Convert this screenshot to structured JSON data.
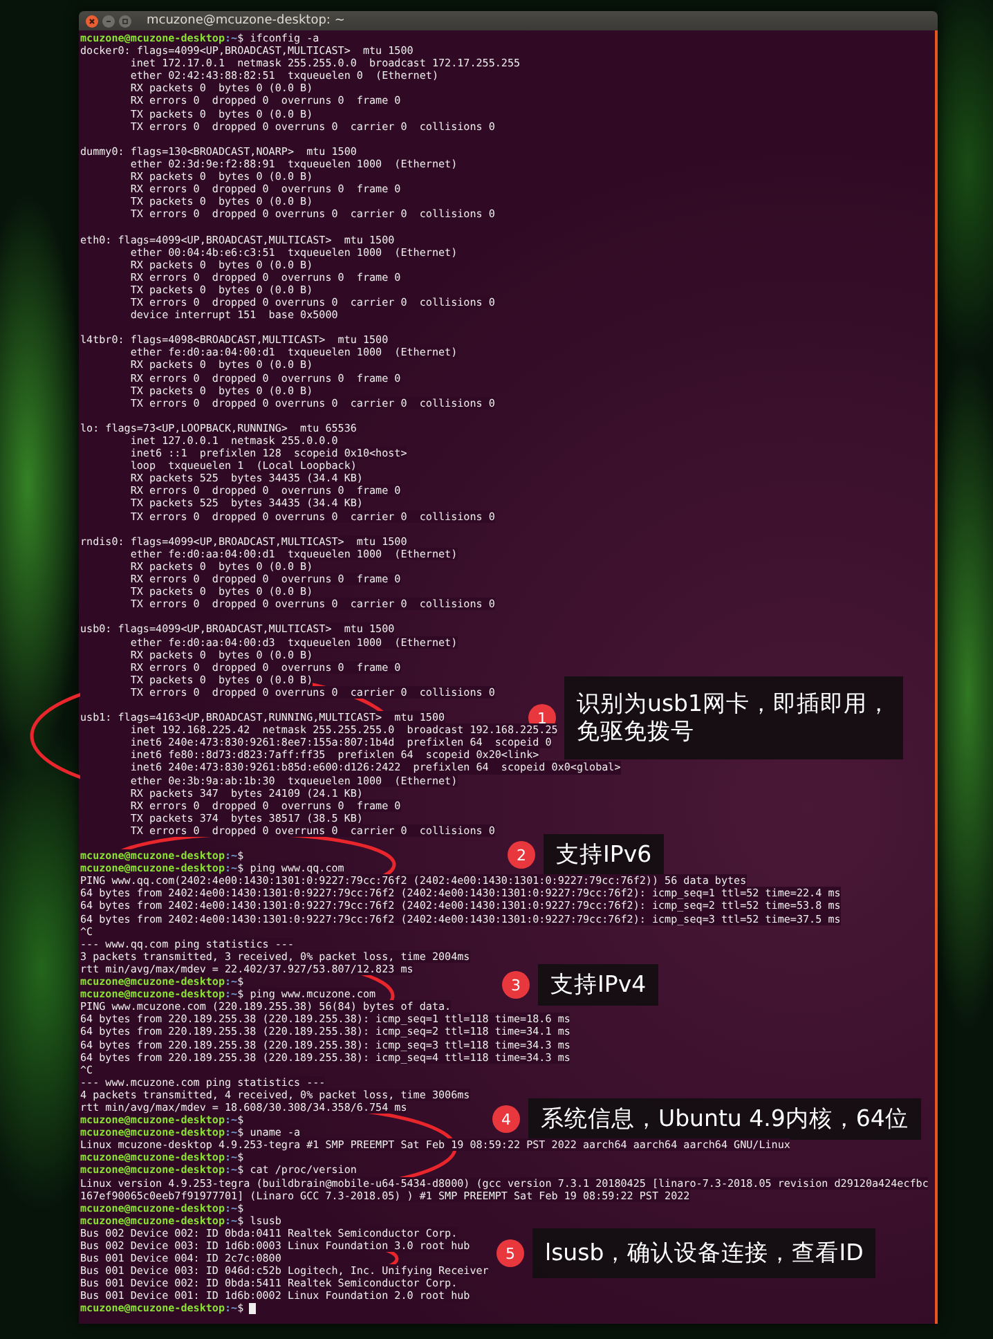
{
  "window": {
    "title": "mcuzone@mcuzone-desktop: ~"
  },
  "terminal": {
    "cursor": true,
    "lines": [
      {
        "kind": "prompt",
        "user": "mcuzone@mcuzone-desktop",
        "path": ":~",
        "command": "$ ifconfig -a"
      },
      {
        "kind": "out",
        "text": "docker0: flags=4099<UP,BROADCAST,MULTICAST>  mtu 1500"
      },
      {
        "kind": "out",
        "text": "        inet 172.17.0.1  netmask 255.255.0.0  broadcast 172.17.255.255"
      },
      {
        "kind": "out",
        "text": "        ether 02:42:43:88:82:51  txqueuelen 0  (Ethernet)"
      },
      {
        "kind": "out",
        "text": "        RX packets 0  bytes 0 (0.0 B)"
      },
      {
        "kind": "out",
        "text": "        RX errors 0  dropped 0  overruns 0  frame 0"
      },
      {
        "kind": "out",
        "text": "        TX packets 0  bytes 0 (0.0 B)"
      },
      {
        "kind": "out",
        "text": "        TX errors 0  dropped 0 overruns 0  carrier 0  collisions 0"
      },
      {
        "kind": "blank"
      },
      {
        "kind": "out",
        "text": "dummy0: flags=130<BROADCAST,NOARP>  mtu 1500"
      },
      {
        "kind": "out",
        "text": "        ether 02:3d:9e:f2:88:91  txqueuelen 1000  (Ethernet)"
      },
      {
        "kind": "out",
        "text": "        RX packets 0  bytes 0 (0.0 B)"
      },
      {
        "kind": "out",
        "text": "        RX errors 0  dropped 0  overruns 0  frame 0"
      },
      {
        "kind": "out",
        "text": "        TX packets 0  bytes 0 (0.0 B)"
      },
      {
        "kind": "out",
        "text": "        TX errors 0  dropped 0 overruns 0  carrier 0  collisions 0"
      },
      {
        "kind": "blank"
      },
      {
        "kind": "out",
        "text": "eth0: flags=4099<UP,BROADCAST,MULTICAST>  mtu 1500"
      },
      {
        "kind": "out",
        "text": "        ether 00:04:4b:e6:c3:51  txqueuelen 1000  (Ethernet)"
      },
      {
        "kind": "out",
        "text": "        RX packets 0  bytes 0 (0.0 B)"
      },
      {
        "kind": "out",
        "text": "        RX errors 0  dropped 0  overruns 0  frame 0"
      },
      {
        "kind": "out",
        "text": "        TX packets 0  bytes 0 (0.0 B)"
      },
      {
        "kind": "out",
        "text": "        TX errors 0  dropped 0 overruns 0  carrier 0  collisions 0"
      },
      {
        "kind": "out",
        "text": "        device interrupt 151  base 0x5000"
      },
      {
        "kind": "blank"
      },
      {
        "kind": "out",
        "text": "l4tbr0: flags=4098<BROADCAST,MULTICAST>  mtu 1500"
      },
      {
        "kind": "out",
        "text": "        ether fe:d0:aa:04:00:d1  txqueuelen 1000  (Ethernet)"
      },
      {
        "kind": "out",
        "text": "        RX packets 0  bytes 0 (0.0 B)"
      },
      {
        "kind": "out",
        "text": "        RX errors 0  dropped 0  overruns 0  frame 0"
      },
      {
        "kind": "out",
        "text": "        TX packets 0  bytes 0 (0.0 B)"
      },
      {
        "kind": "out",
        "text": "        TX errors 0  dropped 0 overruns 0  carrier 0  collisions 0"
      },
      {
        "kind": "blank"
      },
      {
        "kind": "out",
        "text": "lo: flags=73<UP,LOOPBACK,RUNNING>  mtu 65536"
      },
      {
        "kind": "out",
        "text": "        inet 127.0.0.1  netmask 255.0.0.0"
      },
      {
        "kind": "out",
        "text": "        inet6 ::1  prefixlen 128  scopeid 0x10<host>"
      },
      {
        "kind": "out",
        "text": "        loop  txqueuelen 1  (Local Loopback)"
      },
      {
        "kind": "out",
        "text": "        RX packets 525  bytes 34435 (34.4 KB)"
      },
      {
        "kind": "out",
        "text": "        RX errors 0  dropped 0  overruns 0  frame 0"
      },
      {
        "kind": "out",
        "text": "        TX packets 525  bytes 34435 (34.4 KB)"
      },
      {
        "kind": "out",
        "text": "        TX errors 0  dropped 0 overruns 0  carrier 0  collisions 0"
      },
      {
        "kind": "blank"
      },
      {
        "kind": "out",
        "text": "rndis0: flags=4099<UP,BROADCAST,MULTICAST>  mtu 1500"
      },
      {
        "kind": "out",
        "text": "        ether fe:d0:aa:04:00:d1  txqueuelen 1000  (Ethernet)"
      },
      {
        "kind": "out",
        "text": "        RX packets 0  bytes 0 (0.0 B)"
      },
      {
        "kind": "out",
        "text": "        RX errors 0  dropped 0  overruns 0  frame 0"
      },
      {
        "kind": "out",
        "text": "        TX packets 0  bytes 0 (0.0 B)"
      },
      {
        "kind": "out",
        "text": "        TX errors 0  dropped 0 overruns 0  carrier 0  collisions 0"
      },
      {
        "kind": "blank"
      },
      {
        "kind": "out",
        "text": "usb0: flags=4099<UP,BROADCAST,MULTICAST>  mtu 1500"
      },
      {
        "kind": "out",
        "text": "        ether fe:d0:aa:04:00:d3  txqueuelen 1000  (Ethernet)"
      },
      {
        "kind": "out",
        "text": "        RX packets 0  bytes 0 (0.0 B)"
      },
      {
        "kind": "out",
        "text": "        RX errors 0  dropped 0  overruns 0  frame 0"
      },
      {
        "kind": "out",
        "text": "        TX packets 0  bytes 0 (0.0 B)"
      },
      {
        "kind": "out",
        "text": "        TX errors 0  dropped 0 overruns 0  carrier 0  collisions 0"
      },
      {
        "kind": "blank"
      },
      {
        "kind": "out",
        "text": "usb1: flags=4163<UP,BROADCAST,RUNNING,MULTICAST>  mtu 1500"
      },
      {
        "kind": "out",
        "text": "        inet 192.168.225.42  netmask 255.255.255.0  broadcast 192.168.225.25"
      },
      {
        "kind": "out",
        "text": "        inet6 240e:473:830:9261:8ee7:155a:807:1b4d  prefixlen 64  scopeid 0"
      },
      {
        "kind": "out",
        "text": "        inet6 fe80::8d73:d823:7aff:ff35  prefixlen 64  scopeid 0x20<link>"
      },
      {
        "kind": "out",
        "text": "        inet6 240e:473:830:9261:b85d:e600:d126:2422  prefixlen 64  scopeid 0x0<global>"
      },
      {
        "kind": "out",
        "text": "        ether 0e:3b:9a:ab:1b:30  txqueuelen 1000  (Ethernet)"
      },
      {
        "kind": "out",
        "text": "        RX packets 347  bytes 24109 (24.1 KB)"
      },
      {
        "kind": "out",
        "text": "        RX errors 0  dropped 0  overruns 0  frame 0"
      },
      {
        "kind": "out",
        "text": "        TX packets 374  bytes 38517 (38.5 KB)"
      },
      {
        "kind": "out",
        "text": "        TX errors 0  dropped 0 overruns 0  carrier 0  collisions 0"
      },
      {
        "kind": "blank"
      },
      {
        "kind": "prompt",
        "user": "mcuzone@mcuzone-desktop",
        "path": ":~",
        "command": "$"
      },
      {
        "kind": "prompt",
        "user": "mcuzone@mcuzone-desktop",
        "path": ":~",
        "command": "$ ping www.qq.com"
      },
      {
        "kind": "out",
        "text": "PING www.qq.com(2402:4e00:1430:1301:0:9227:79cc:76f2 (2402:4e00:1430:1301:0:9227:79cc:76f2)) 56 data bytes"
      },
      {
        "kind": "out",
        "text": "64 bytes from 2402:4e00:1430:1301:0:9227:79cc:76f2 (2402:4e00:1430:1301:0:9227:79cc:76f2): icmp_seq=1 ttl=52 time=22.4 ms"
      },
      {
        "kind": "out",
        "text": "64 bytes from 2402:4e00:1430:1301:0:9227:79cc:76f2 (2402:4e00:1430:1301:0:9227:79cc:76f2): icmp_seq=2 ttl=52 time=53.8 ms"
      },
      {
        "kind": "out",
        "text": "64 bytes from 2402:4e00:1430:1301:0:9227:79cc:76f2 (2402:4e00:1430:1301:0:9227:79cc:76f2): icmp_seq=3 ttl=52 time=37.5 ms"
      },
      {
        "kind": "out",
        "text": "^C"
      },
      {
        "kind": "out",
        "text": "--- www.qq.com ping statistics ---"
      },
      {
        "kind": "out",
        "text": "3 packets transmitted, 3 received, 0% packet loss, time 2004ms"
      },
      {
        "kind": "out",
        "text": "rtt min/avg/max/mdev = 22.402/37.927/53.807/12.823 ms"
      },
      {
        "kind": "prompt",
        "user": "mcuzone@mcuzone-desktop",
        "path": ":~",
        "command": "$"
      },
      {
        "kind": "prompt",
        "user": "mcuzone@mcuzone-desktop",
        "path": ":~",
        "command": "$ ping www.mcuzone.com"
      },
      {
        "kind": "out",
        "text": "PING www.mcuzone.com (220.189.255.38) 56(84) bytes of data."
      },
      {
        "kind": "out",
        "text": "64 bytes from 220.189.255.38 (220.189.255.38): icmp_seq=1 ttl=118 time=18.6 ms"
      },
      {
        "kind": "out",
        "text": "64 bytes from 220.189.255.38 (220.189.255.38): icmp_seq=2 ttl=118 time=34.1 ms"
      },
      {
        "kind": "out",
        "text": "64 bytes from 220.189.255.38 (220.189.255.38): icmp_seq=3 ttl=118 time=34.3 ms"
      },
      {
        "kind": "out",
        "text": "64 bytes from 220.189.255.38 (220.189.255.38): icmp_seq=4 ttl=118 time=34.3 ms"
      },
      {
        "kind": "out",
        "text": "^C"
      },
      {
        "kind": "out",
        "text": "--- www.mcuzone.com ping statistics ---"
      },
      {
        "kind": "out",
        "text": "4 packets transmitted, 4 received, 0% packet loss, time 3006ms"
      },
      {
        "kind": "out",
        "text": "rtt min/avg/max/mdev = 18.608/30.308/34.358/6.754 ms"
      },
      {
        "kind": "prompt",
        "user": "mcuzone@mcuzone-desktop",
        "path": ":~",
        "command": "$"
      },
      {
        "kind": "prompt",
        "user": "mcuzone@mcuzone-desktop",
        "path": ":~",
        "command": "$ uname -a"
      },
      {
        "kind": "out",
        "text": "Linux mcuzone-desktop 4.9.253-tegra #1 SMP PREEMPT Sat Feb 19 08:59:22 PST 2022 aarch64 aarch64 aarch64 GNU/Linux"
      },
      {
        "kind": "prompt",
        "user": "mcuzone@mcuzone-desktop",
        "path": ":~",
        "command": "$"
      },
      {
        "kind": "prompt",
        "user": "mcuzone@mcuzone-desktop",
        "path": ":~",
        "command": "$ cat /proc/version"
      },
      {
        "kind": "out",
        "text": "Linux version 4.9.253-tegra (buildbrain@mobile-u64-5434-d8000) (gcc version 7.3.1 20180425 [linaro-7.3-2018.05 revision d29120a424ecfbc"
      },
      {
        "kind": "out",
        "text": "167ef90065c0eeb7f91977701] (Linaro GCC 7.3-2018.05) ) #1 SMP PREEMPT Sat Feb 19 08:59:22 PST 2022"
      },
      {
        "kind": "prompt",
        "user": "mcuzone@mcuzone-desktop",
        "path": ":~",
        "command": "$"
      },
      {
        "kind": "prompt",
        "user": "mcuzone@mcuzone-desktop",
        "path": ":~",
        "command": "$ lsusb"
      },
      {
        "kind": "out",
        "text": "Bus 002 Device 002: ID 0bda:0411 Realtek Semiconductor Corp."
      },
      {
        "kind": "out",
        "text": "Bus 002 Device 003: ID 1d6b:0003 Linux Foundation 3.0 root hub"
      },
      {
        "kind": "out",
        "text": "Bus 001 Device 004: ID 2c7c:0800"
      },
      {
        "kind": "out",
        "text": "Bus 001 Device 003: ID 046d:c52b Logitech, Inc. Unifying Receiver"
      },
      {
        "kind": "out",
        "text": "Bus 001 Device 002: ID 0bda:5411 Realtek Semiconductor Corp."
      },
      {
        "kind": "out",
        "text": "Bus 001 Device 001: ID 1d6b:0002 Linux Foundation 2.0 root hub"
      },
      {
        "kind": "prompt",
        "user": "mcuzone@mcuzone-desktop",
        "path": ":~",
        "command": "$"
      }
    ]
  },
  "annotations": [
    {
      "number": "1",
      "lines": [
        "识别为usb1网卡，即插即用，",
        "免驱免拨号"
      ]
    },
    {
      "number": "2",
      "lines": [
        "支持IPv6"
      ]
    },
    {
      "number": "3",
      "lines": [
        "支持IPv4"
      ]
    },
    {
      "number": "4",
      "lines": [
        "系统信息，Ubuntu 4.9内核，64位"
      ]
    },
    {
      "number": "5",
      "lines": [
        "lsusb，确认设备连接，查看ID"
      ]
    }
  ]
}
